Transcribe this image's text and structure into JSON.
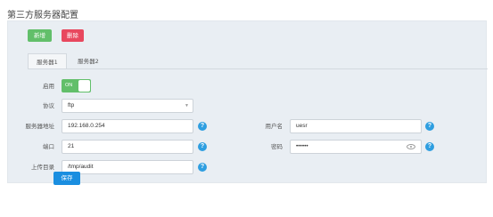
{
  "page": {
    "title": "第三方服务器配置"
  },
  "toolbar": {
    "add_label": "新增",
    "delete_label": "删除"
  },
  "tabs": [
    {
      "label": "服务器1",
      "active": true
    },
    {
      "label": "服务器2",
      "active": false
    }
  ],
  "form": {
    "enable": {
      "label": "启用",
      "value": "ON"
    },
    "protocol": {
      "label": "协议",
      "value": "ftp"
    },
    "server_address": {
      "label": "服务器地址",
      "value": "192.168.0.254"
    },
    "port": {
      "label": "端口",
      "value": "21"
    },
    "upload_dir": {
      "label": "上传目录",
      "value": "/tmp/audit"
    },
    "username": {
      "label": "用户名",
      "value": "uesr"
    },
    "password": {
      "label": "密码",
      "value": "••••••"
    },
    "help_glyph": "?"
  },
  "footer": {
    "save_label": "保存"
  },
  "colors": {
    "add": "#62bf6a",
    "delete": "#e8485e",
    "toggle_on": "#62bf6a",
    "help": "#2e9ee0",
    "save": "#1a8ee0",
    "panel_bg": "#e9eef3"
  },
  "icons": {
    "help": "question-circle-icon",
    "select": "caret-down-icon",
    "password": "eye-icon"
  }
}
